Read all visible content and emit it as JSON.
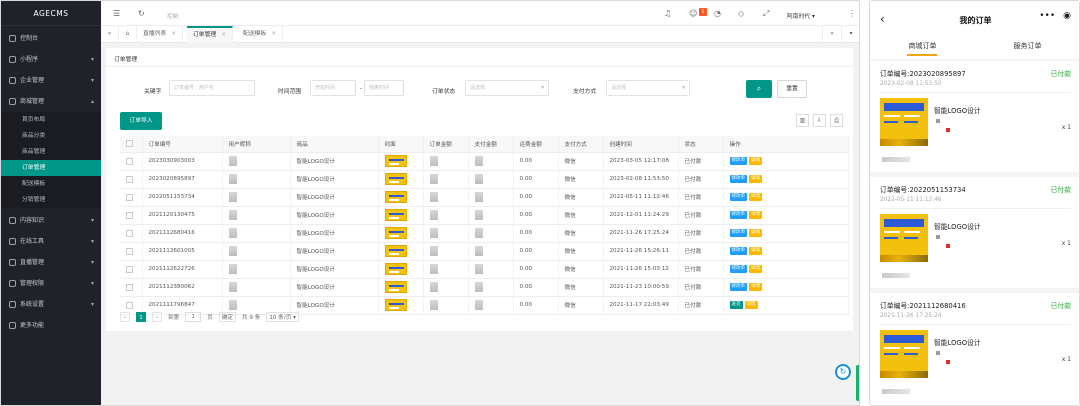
{
  "admin": {
    "logo": "AGECMS",
    "nav": {
      "dashboard": "控制台",
      "mini": "小程序",
      "enterprise": "企业管理",
      "mall": "商城管理",
      "mall_sub": [
        "首页布局",
        "商品分类",
        "商品管理",
        "订单管理",
        "配送模板",
        "分销管理"
      ],
      "content": "内容知识",
      "tools": "在线工具",
      "live": "直播管理",
      "perm": "管理权限",
      "system": "系统设置",
      "more": "更多功能"
    },
    "topbar": {
      "breadcrumb": "控制",
      "user": "阿南时代 ▾",
      "notice_badge": "1"
    },
    "tabs": [
      "直播列表",
      "订单管理",
      "配送模板"
    ],
    "panel_title": "订单管理",
    "filters": {
      "keyword_label": "关键字",
      "keyword_placeholder": "订单编号、用户名",
      "time_label": "时间范围",
      "start_placeholder": "开始时间",
      "end_placeholder": "结束时间",
      "status_label": "订单状态",
      "status_placeholder": "请选择",
      "pay_label": "支付方式",
      "pay_placeholder": "请选择",
      "reset": "重置",
      "range_sep": "-"
    },
    "import_button": "订单导入",
    "table": {
      "headers": [
        "订单编号",
        "用户昵称",
        "商品",
        "封面",
        "订单金额",
        "支付金额",
        "运费金额",
        "支付方式",
        "创建时间",
        "状态",
        "操作"
      ],
      "rows": [
        {
          "no": "2023030903003",
          "product": "智能LOGO设计",
          "amount": "",
          "pay": "",
          "freight": "0.00",
          "method": "微信",
          "created": "2023-03-05 12:17:08",
          "status": "已付款",
          "actions": [
            "修改单",
            "详情"
          ]
        },
        {
          "no": "2023020895897",
          "product": "智能LOGO设计",
          "amount": "",
          "pay": "",
          "freight": "0.00",
          "method": "微信",
          "created": "2023-02-08 11:53:50",
          "status": "已付款",
          "actions": [
            "修改单",
            "详情"
          ]
        },
        {
          "no": "2022051153734",
          "product": "智能LOGO设计",
          "amount": "",
          "pay": "",
          "freight": "0.00",
          "method": "微信",
          "created": "2022-05-11 11:12:46",
          "status": "已付款",
          "actions": [
            "修改单",
            "详情"
          ]
        },
        {
          "no": "2021120130475",
          "product": "智能LOGO设计",
          "amount": "",
          "pay": "",
          "freight": "0.00",
          "method": "微信",
          "created": "2021-12-01 11:24:29",
          "status": "已付款",
          "actions": [
            "修改单",
            "详情"
          ]
        },
        {
          "no": "2021112680416",
          "product": "智能LOGO设计",
          "amount": "",
          "pay": "",
          "freight": "0.00",
          "method": "微信",
          "created": "2021-11-26 17:25:24",
          "status": "已付款",
          "actions": [
            "修改单",
            "详情"
          ]
        },
        {
          "no": "2021112601005",
          "product": "智能LOGO设计",
          "amount": "",
          "pay": "",
          "freight": "0.00",
          "method": "微信",
          "created": "2021-11-26 15:26:11",
          "status": "已付款",
          "actions": [
            "修改单",
            "详情"
          ]
        },
        {
          "no": "2021112622726",
          "product": "智能LOGO设计",
          "amount": "",
          "pay": "",
          "freight": "0.00",
          "method": "微信",
          "created": "2021-11-26 15:03:12",
          "status": "已付款",
          "actions": [
            "修改单",
            "详情"
          ]
        },
        {
          "no": "2021112380062",
          "product": "智能LOGO设计",
          "amount": "",
          "pay": "",
          "freight": "0.00",
          "method": "微信",
          "created": "2021-11-23 10:00:59",
          "status": "已付款",
          "actions": [
            "修改单",
            "详情"
          ]
        },
        {
          "no": "2021111796847",
          "product": "智能LOGO设计",
          "amount": "",
          "pay": "",
          "freight": "0.00",
          "method": "微信",
          "created": "2021-11-17 22:03:49",
          "status": "已付款",
          "actions": [
            "发货",
            "详情"
          ]
        }
      ]
    },
    "pager": {
      "current": "1",
      "goto_label": "到第",
      "page_input": "1",
      "page_unit": "页",
      "confirm": "确定",
      "total": "共 9 条",
      "page_size": "10 条/页 ▾"
    }
  },
  "mobile": {
    "title": "我的订单",
    "tabs": [
      "商城订单",
      "服务订单"
    ],
    "accent": "#f2a417",
    "orders": [
      {
        "label": "订单编号:2023020895897",
        "status": "已付款",
        "time": "2023-02-08 11:53:50",
        "product": "智能LOGO设计",
        "qty": "x 1"
      },
      {
        "label": "订单编号:2022051153734",
        "status": "已付款",
        "time": "2022-05-11 11:12:46",
        "product": "智能LOGO设计",
        "qty": "x 1"
      },
      {
        "label": "订单编号:2021112680416",
        "status": "已付款",
        "time": "2021-11-26 17:25:24",
        "product": "智能LOGO设计",
        "qty": "x 1"
      }
    ]
  }
}
